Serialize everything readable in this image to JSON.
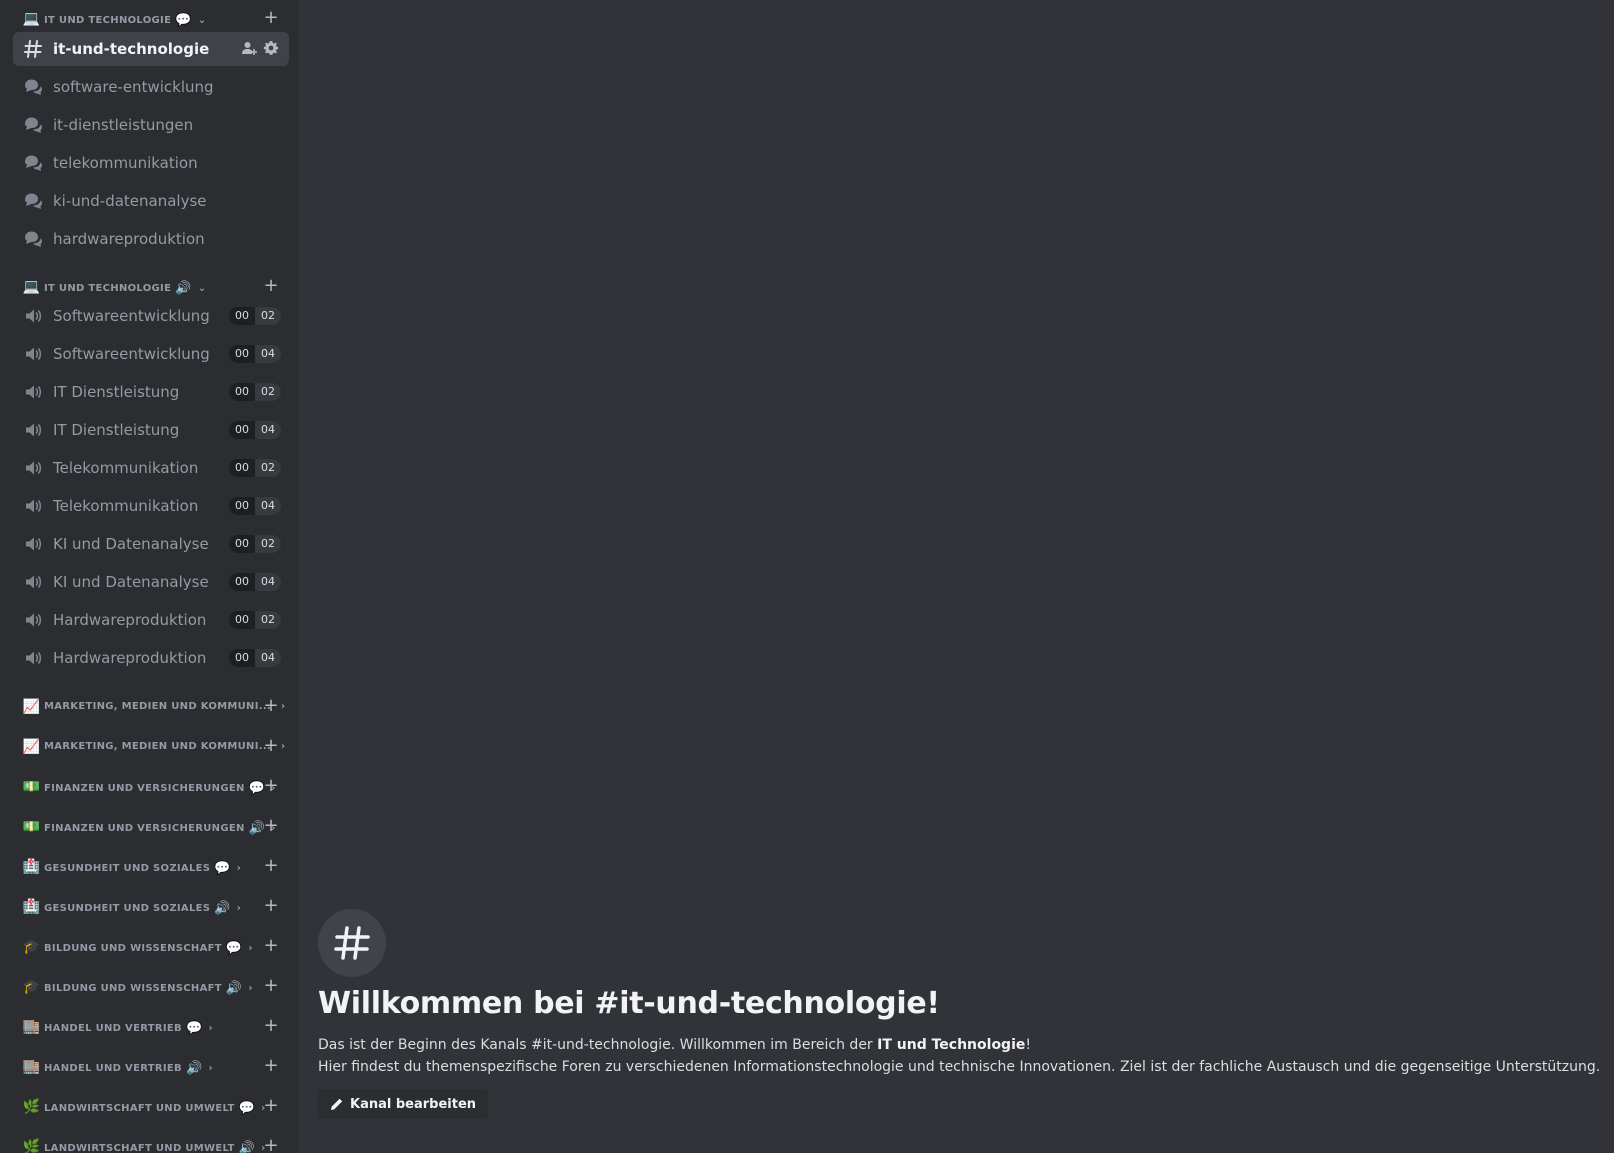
{
  "sidebar": {
    "categories_top": [
      {
        "emoji": "💻",
        "label": "IT UND TECHNOLOGIE",
        "suffix": "💬",
        "chevron": "⌄"
      },
      {
        "emoji": "💻",
        "label": "IT UND TECHNOLOGIE",
        "suffix": "🔊",
        "chevron": "⌄"
      }
    ],
    "text_channels": [
      {
        "name": "it-und-technologie",
        "icon": "hash-icon",
        "active": true
      },
      {
        "name": "software-entwicklung",
        "icon": "forum-icon"
      },
      {
        "name": "it-dienstleistungen",
        "icon": "forum-icon"
      },
      {
        "name": "telekommunikation",
        "icon": "forum-icon"
      },
      {
        "name": "ki-und-datenanalyse",
        "icon": "forum-icon"
      },
      {
        "name": "hardwareproduktion",
        "icon": "forum-icon"
      }
    ],
    "voice_channels": [
      {
        "name": "Softwareentwicklung",
        "count": "00",
        "max": "02"
      },
      {
        "name": "Softwareentwicklung",
        "count": "00",
        "max": "04"
      },
      {
        "name": "IT Dienstleistung",
        "count": "00",
        "max": "02"
      },
      {
        "name": "IT Dienstleistung",
        "count": "00",
        "max": "04"
      },
      {
        "name": "Telekommunikation",
        "count": "00",
        "max": "02"
      },
      {
        "name": "Telekommunikation",
        "count": "00",
        "max": "04"
      },
      {
        "name": "KI und Datenanalyse",
        "count": "00",
        "max": "02"
      },
      {
        "name": "KI und Datenanalyse",
        "count": "00",
        "max": "04"
      },
      {
        "name": "Hardwareproduktion",
        "count": "00",
        "max": "02"
      },
      {
        "name": "Hardwareproduktion",
        "count": "00",
        "max": "04"
      }
    ],
    "collapsed_categories": [
      {
        "emoji": "📈",
        "label": "MARKETING, MEDIEN UND KOMMUNI...",
        "suffix": "",
        "chevron": "›"
      },
      {
        "emoji": "📈",
        "label": "MARKETING, MEDIEN UND KOMMUNI...",
        "suffix": "",
        "chevron": "›"
      },
      {
        "emoji": "💵",
        "label": "FINANZEN UND VERSICHERUNGEN",
        "suffix": "💬",
        "chevron": "›"
      },
      {
        "emoji": "💵",
        "label": "FINANZEN UND VERSICHERUNGEN",
        "suffix": "🔊",
        "chevron": "›"
      },
      {
        "emoji": "🏥",
        "label": "GESUNDHEIT UND SOZIALES",
        "suffix": "💬",
        "chevron": "›"
      },
      {
        "emoji": "🏥",
        "label": "GESUNDHEIT UND SOZIALES",
        "suffix": "🔊",
        "chevron": "›"
      },
      {
        "emoji": "🎓",
        "label": "BILDUNG UND WISSENSCHAFT",
        "suffix": "💬",
        "chevron": "›"
      },
      {
        "emoji": "🎓",
        "label": "BILDUNG UND WISSENSCHAFT",
        "suffix": "🔊",
        "chevron": "›"
      },
      {
        "emoji": "🏬",
        "label": "HANDEL UND VERTRIEB",
        "suffix": "💬",
        "chevron": "›"
      },
      {
        "emoji": "🏬",
        "label": "HANDEL UND VERTRIEB",
        "suffix": "🔊",
        "chevron": "›"
      },
      {
        "emoji": "🌿",
        "label": "LANDWIRTSCHAFT UND UMWELT",
        "suffix": "💬",
        "chevron": "›"
      },
      {
        "emoji": "🌿",
        "label": "LANDWIRTSCHAFT UND UMWELT",
        "suffix": "🔊",
        "chevron": "›"
      }
    ],
    "plus_label": "+"
  },
  "welcome": {
    "badge": "#",
    "title": "Willkommen bei #it-und-technologie!",
    "line1_pre": "Das ist der Beginn des Kanals #it-und-technologie. Willkommen im Bereich der ",
    "line1_bold": "IT und Technologie",
    "line1_post": "!",
    "line2": "Hier findest du themenspezifische Foren zu verschiedenen Informationstechnologie und technische Innovationen. Ziel ist der fachliche Austausch und die gegenseitige Unterstützung.",
    "edit_button": "Kanal bearbeiten"
  },
  "colors": {
    "background": "#313338",
    "sidebar": "#2b2d31",
    "active": "#404249",
    "muted": "#949ba4"
  }
}
